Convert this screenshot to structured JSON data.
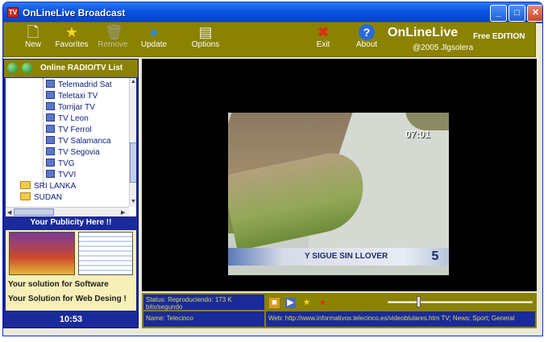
{
  "window": {
    "title": "OnLineLive Broadcast",
    "app_icon_text": "TV"
  },
  "title_buttons": {
    "minimize": "_",
    "maximize": "□",
    "close": "✕"
  },
  "toolbar": {
    "buttons": [
      {
        "label": "New",
        "icon": "new-document-icon",
        "glyph": "🗋"
      },
      {
        "label": "Favorites",
        "icon": "star-icon",
        "glyph": "★"
      },
      {
        "label": "Remove",
        "icon": "trash-icon",
        "glyph": "🗑"
      },
      {
        "label": "Update",
        "icon": "globe-icon",
        "glyph": "●"
      },
      {
        "label": "Options",
        "icon": "options-icon",
        "glyph": "▤"
      },
      {
        "label": "Exit",
        "icon": "exit-icon",
        "glyph": "✖"
      },
      {
        "label": "About",
        "icon": "about-icon",
        "glyph": "?"
      }
    ],
    "brand": "OnLineLive",
    "edition": "Free EDITION",
    "copyright": "@2005 Jlgsolera"
  },
  "sidebar": {
    "header": "Online RADIO/TV List",
    "channels": [
      "Telemadrid Sat",
      "Teletaxi TV",
      "Torrijar TV",
      "TV Leon",
      "TV Ferrol",
      "TV Salamanca",
      "TV Segovia",
      "TVG",
      "TVVI"
    ],
    "folders": [
      "SRI LANKA",
      "SUDAN"
    ],
    "publicity_title": "Your Publicity Here !!",
    "ad_lines": [
      "Your solution for Software",
      "Your Solution for Web Desing !"
    ],
    "clock": "10:53"
  },
  "video": {
    "channel_mark": "07:01",
    "ticker": "Y SIGUE SIN LLOVER",
    "logo": "5"
  },
  "status": {
    "status_text": "Status: Reproduciendo: 173 K bits/segundo",
    "name_text": "Name: Telecinco",
    "web_text": "Web: http://www.informativos.telecinco.es/videoblulares.htm TV; News; Sport; General"
  },
  "controls": {
    "volume_level": 0.2
  },
  "colors": {
    "toolbar": "#8a8200",
    "panel": "#1a2a9a",
    "titlebar": "#0a56e0"
  }
}
